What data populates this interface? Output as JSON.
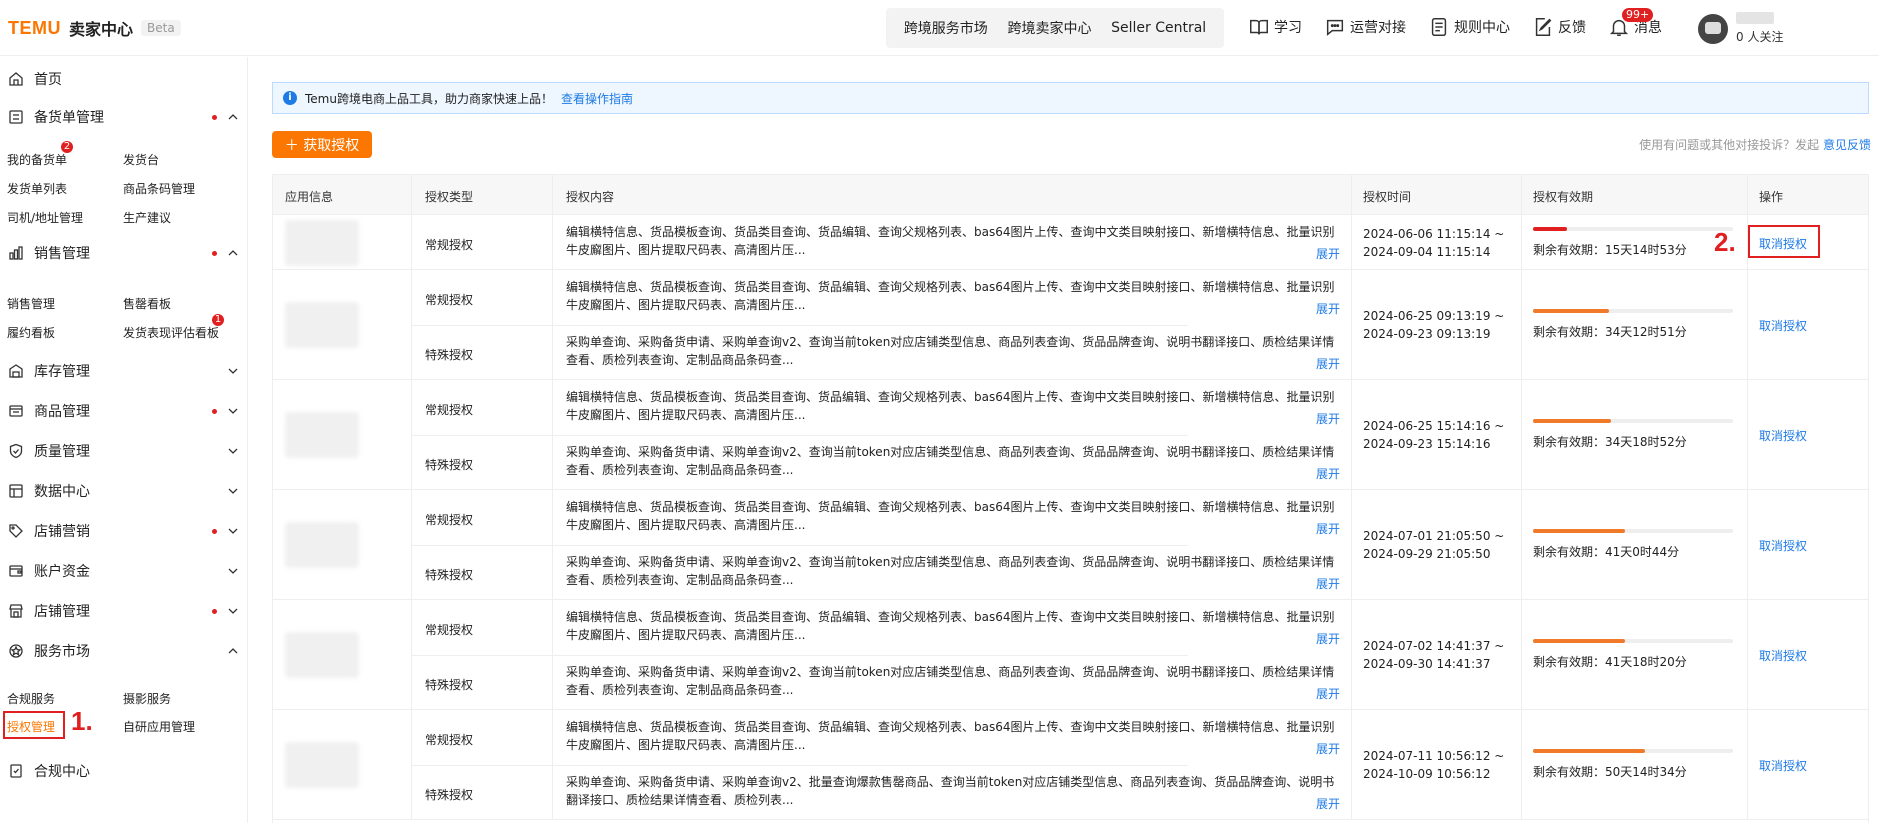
{
  "header": {
    "logo": "TEMU",
    "title": "卖家中心",
    "beta": "Beta",
    "center_tabs": [
      "跨境服务市场",
      "跨境卖家中心",
      "Seller Central"
    ],
    "actions": [
      {
        "label": "学习",
        "icon": "book-icon"
      },
      {
        "label": "运营对接",
        "icon": "chat-icon"
      },
      {
        "label": "规则中心",
        "icon": "document-icon"
      },
      {
        "label": "反馈",
        "icon": "edit-icon"
      },
      {
        "label": "消息",
        "icon": "bell-icon",
        "badge": "99+"
      }
    ],
    "user": {
      "follow": "0 人关注"
    }
  },
  "sidebar": {
    "home": "首页",
    "groups": [
      {
        "label": "备货单管理",
        "icon": "list-icon",
        "dot": true,
        "expanded": true
      },
      {
        "label": "销售管理",
        "icon": "chart-icon",
        "dot": true,
        "expanded": true
      },
      {
        "label": "库存管理",
        "icon": "warehouse-icon",
        "dot": false,
        "expanded": false
      },
      {
        "label": "商品管理",
        "icon": "product-icon",
        "dot": true,
        "expanded": false
      },
      {
        "label": "质量管理",
        "icon": "shield-icon",
        "dot": false,
        "expanded": false
      },
      {
        "label": "数据中心",
        "icon": "data-icon",
        "dot": false,
        "expanded": false
      },
      {
        "label": "店铺营销",
        "icon": "tag-icon",
        "dot": true,
        "expanded": false
      },
      {
        "label": "账户资金",
        "icon": "wallet-icon",
        "dot": false,
        "expanded": false
      },
      {
        "label": "店铺管理",
        "icon": "store-icon",
        "dot": true,
        "expanded": false
      },
      {
        "label": "服务市场",
        "icon": "service-icon",
        "dot": false,
        "expanded": true
      }
    ],
    "stock_items": [
      "我的备货单",
      "发货台",
      "发货单列表",
      "商品条码管理",
      "司机/地址管理",
      "生产建议"
    ],
    "stock_badge": "2",
    "sales_items": [
      "销售管理",
      "售罄看板",
      "履约看板",
      "发货表现评估看板"
    ],
    "sales_badge": "1",
    "service_items": [
      "合规服务",
      "摄影服务",
      "授权管理",
      "自研应用管理"
    ],
    "compliance": "合规中心",
    "step1": "1.",
    "step2": "2."
  },
  "notice": {
    "text": "Temu跨境电商上品工具，助力商家快速上品！",
    "link": "查看操作指南"
  },
  "toolbar": {
    "get_auth": "＋ 获取授权",
    "feedback_text": "使用有问题或其他对接投诉？发起",
    "feedback_link": "意见反馈"
  },
  "table": {
    "headers": [
      "应用信息",
      "授权类型",
      "授权内容",
      "授权时间",
      "授权有效期",
      "操作"
    ],
    "expand": "展开",
    "cancel": "取消授权",
    "types": {
      "normal": "常规授权",
      "special": "特殊授权"
    },
    "content_normal_1": "编辑横特信息、货品模板查询、货品类目查询、货品编辑、查询父规格列表、bas64图片上传、查询中文类目映射接口、新增横特信息、批量识别",
    "content_normal_2": "牛皮廨图片、图片提取尺码表、高清图片压...",
    "content_special_1": "采购单查询、采购备货申请、采购单查询v2、查询当前token对应店铺类型信息、商品列表查询、货品品牌查询、说明书翻译接口、质检结果详情",
    "content_special_2": "查看、质检列表查询、定制品商品条码查...",
    "content_special5_1": "采购单查询、采购备货申请、采购单查询v2、批量查询爆款售罄商品、查询当前token对应店铺类型信息、商品列表查询、货品品牌查询、说明书",
    "content_special5_2": "翻译接口、质检结果详情查看、质检列表...",
    "rows": [
      {
        "time_start": "2024-06-06 11:15:14 ~",
        "time_end": "2024-09-04 11:15:14",
        "validity": "剩余有效期：15天14时53分",
        "remaining_fraction": 0.17,
        "bar_color": "#e02020",
        "has_special": false,
        "special_key": ""
      },
      {
        "time_start": "2024-06-25 09:13:19 ~",
        "time_end": "2024-09-23 09:13:19",
        "validity": "剩余有效期：34天12时51分",
        "remaining_fraction": 0.38,
        "bar_color": "#f07a2a",
        "has_special": true,
        "special_key": "content_special"
      },
      {
        "time_start": "2024-06-25 15:14:16 ~",
        "time_end": "2024-09-23 15:14:16",
        "validity": "剩余有效期：34天18时52分",
        "remaining_fraction": 0.39,
        "bar_color": "#f07a2a",
        "has_special": true,
        "special_key": "content_special"
      },
      {
        "time_start": "2024-07-01 21:05:50 ~",
        "time_end": "2024-09-29 21:05:50",
        "validity": "剩余有效期：41天0时44分",
        "remaining_fraction": 0.46,
        "bar_color": "#f07a2a",
        "has_special": true,
        "special_key": "content_special"
      },
      {
        "time_start": "2024-07-02 14:41:37 ~",
        "time_end": "2024-09-30 14:41:37",
        "validity": "剩余有效期：41天18时20分",
        "remaining_fraction": 0.46,
        "bar_color": "#f07a2a",
        "has_special": true,
        "special_key": "content_special"
      },
      {
        "time_start": "2024-07-11 10:56:12 ~",
        "time_end": "2024-10-09 10:56:12",
        "validity": "剩余有效期：50天14时34分",
        "remaining_fraction": 0.56,
        "bar_color": "#f07a2a",
        "has_special": true,
        "special_key": "content_special5"
      }
    ]
  }
}
